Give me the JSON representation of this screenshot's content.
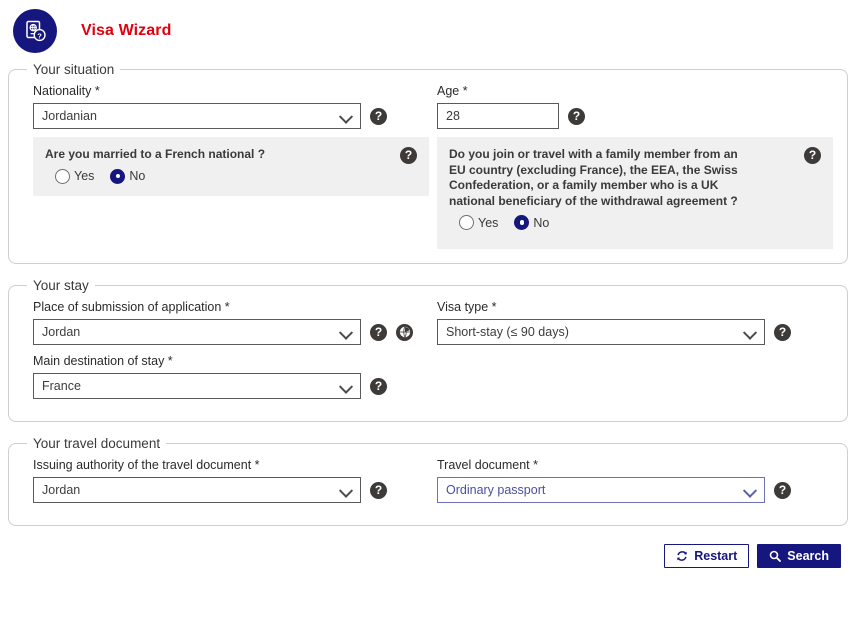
{
  "header": {
    "title": "Visa Wizard",
    "logo_icon": "passport-question-icon",
    "brand_color": "#e1000f",
    "logo_bg": "#16167f"
  },
  "sections": [
    {
      "legend": "Your situation",
      "nationality": {
        "label": "Nationality *",
        "value": "Jordanian",
        "help_icon": "help-icon"
      },
      "age": {
        "label": "Age *",
        "value": "28",
        "placeholder": "",
        "help_icon": "help-icon"
      },
      "married_question": {
        "text": "Are you married to a French national ?",
        "help_icon": "help-icon",
        "options": [
          "Yes",
          "No"
        ],
        "selected": "No"
      },
      "family_question": {
        "text": "Do you join or travel with a family member from an EU country (excluding France), the EEA, the Swiss Confederation, or a family member who is a UK national beneficiary of the withdrawal agreement ?",
        "help_icon": "help-icon",
        "options": [
          "Yes",
          "No"
        ],
        "selected": "No"
      }
    },
    {
      "legend": "Your stay",
      "place_of_submission": {
        "label": "Place of submission of application *",
        "value": "Jordan",
        "help_icon": "help-icon",
        "globe_icon": "globe-icon"
      },
      "visa_type": {
        "label": "Visa type *",
        "value": "Short-stay (≤ 90 days)",
        "help_icon": "help-icon"
      },
      "main_destination": {
        "label": "Main destination of stay *",
        "value": "France",
        "help_icon": "help-icon"
      }
    },
    {
      "legend": "Your travel document",
      "issuing_authority": {
        "label": "Issuing authority of the travel document *",
        "value": "Jordan",
        "help_icon": "help-icon"
      },
      "travel_document": {
        "label": "Travel document *",
        "value": "Ordinary passport",
        "help_icon": "help-icon"
      }
    }
  ],
  "footer": {
    "restart_label": "Restart",
    "restart_icon": "refresh-icon",
    "search_label": "Search",
    "search_icon": "search-icon",
    "accent_color": "#16167f"
  }
}
